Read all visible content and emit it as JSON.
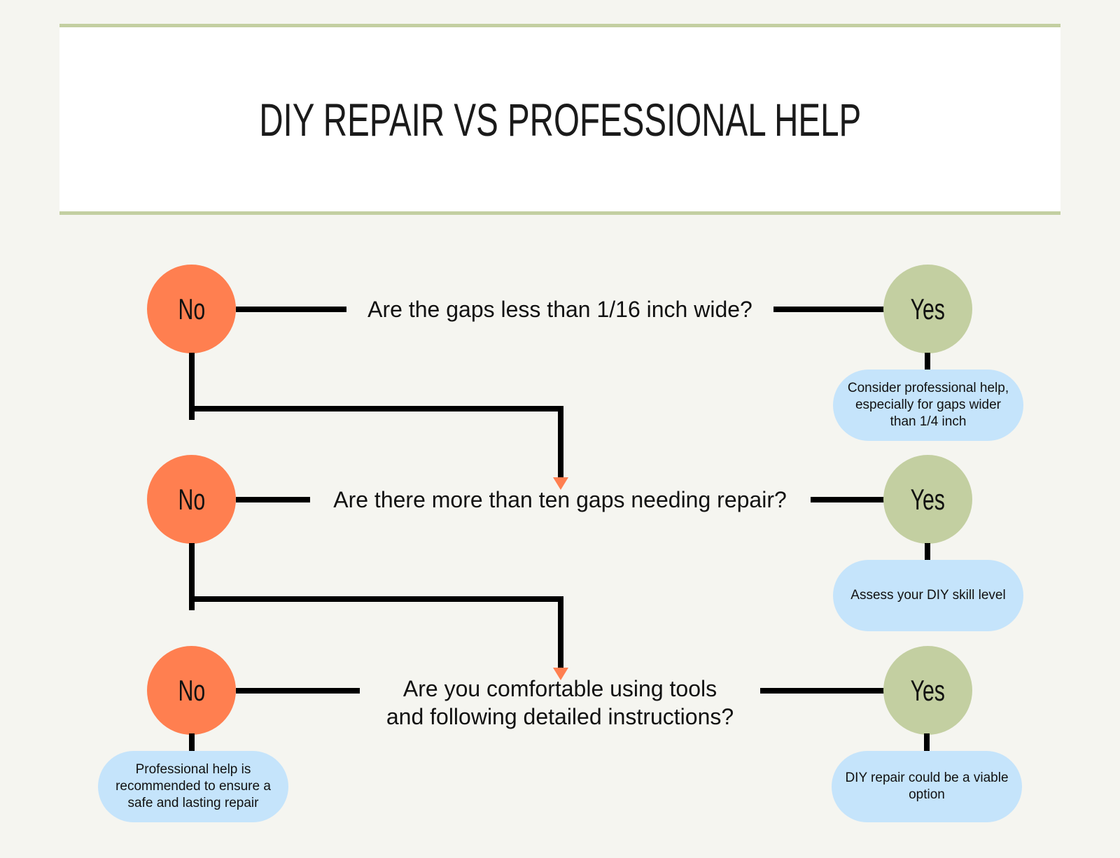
{
  "title": "DIY REPAIR VS PROFESSIONAL HELP",
  "colors": {
    "background": "#f5f5f0",
    "header_border": "#c3cfa1",
    "no_circle": "#ff7f50",
    "yes_circle": "#c3cfa1",
    "outcome_pill": "#c5e4fb",
    "arrow": "#ff7f50",
    "connector": "#000000"
  },
  "rows": [
    {
      "question": "Are the gaps less than 1/16 inch wide?",
      "no_label": "No",
      "yes_label": "Yes",
      "yes_outcome": "Consider professional help, especially for gaps wider than 1/4 inch",
      "no_next": "row 2"
    },
    {
      "question": "Are there more than ten gaps needing repair?",
      "no_label": "No",
      "yes_label": "Yes",
      "yes_outcome": "Assess your DIY skill level",
      "no_next": "row 3"
    },
    {
      "question_line1": "Are you comfortable using tools",
      "question_line2": "and following detailed instructions?",
      "no_label": "No",
      "yes_label": "Yes",
      "no_outcome": "Professional help is recommended to ensure a safe and lasting repair",
      "yes_outcome": "DIY repair could be a viable option"
    }
  ]
}
